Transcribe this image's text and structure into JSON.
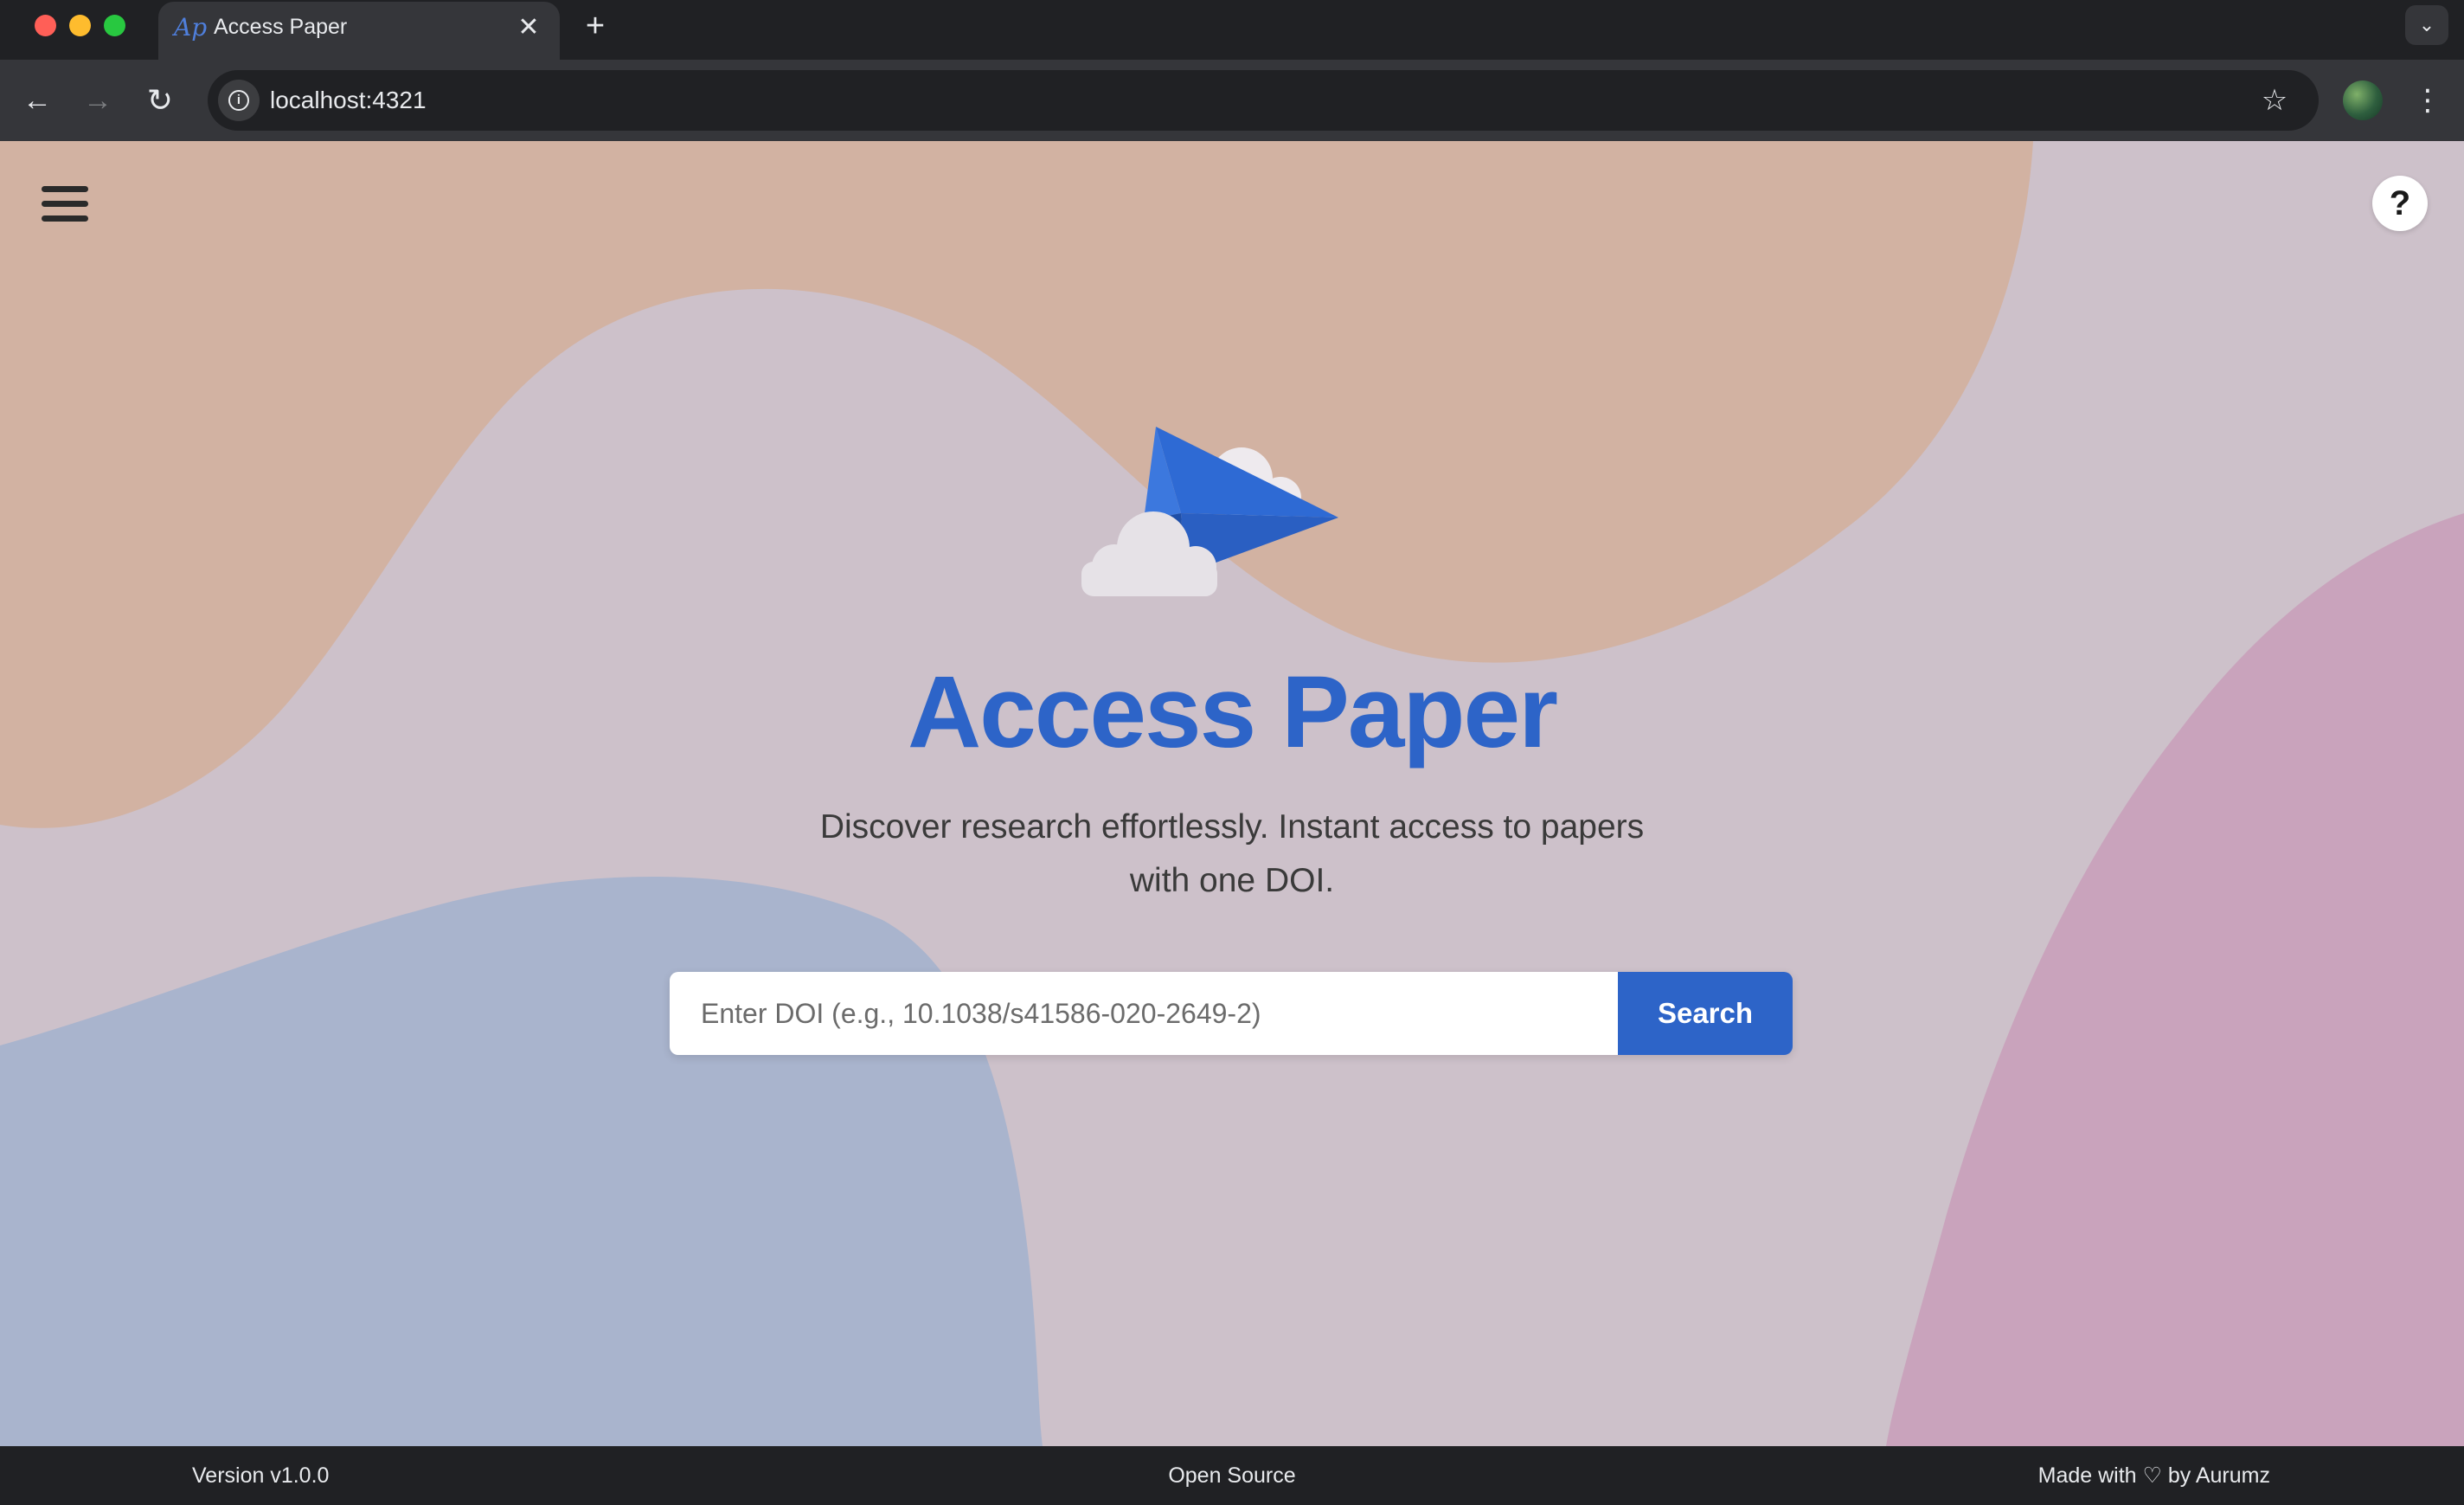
{
  "browser": {
    "tab_title": "Access Paper",
    "tab_favicon": "Ap",
    "tab_close_glyph": "✕",
    "new_tab_glyph": "+",
    "tab_search_glyph": "⌄",
    "url": "localhost:4321",
    "back_glyph": "←",
    "forward_glyph": "→",
    "reload_glyph": "↻",
    "info_glyph": "i",
    "star_glyph": "☆",
    "menu_glyph": "⋮"
  },
  "header": {
    "menu_icon": "hamburger-icon",
    "help_label": "?"
  },
  "hero": {
    "logo_icon": "paper-plane-icon",
    "title": "Access Paper",
    "subtitle_line1": "Discover research effortlessly. Instant access to papers",
    "subtitle_line2": "with one DOI."
  },
  "search": {
    "placeholder": "Enter DOI (e.g., 10.1038/s41586-020-2649-2)",
    "value": "",
    "button_label": "Search"
  },
  "footer": {
    "version": "Version v1.0.0",
    "center": "Open Source",
    "credit": "Made with ♡ by Aurumz"
  },
  "colors": {
    "accent": "#2d64c8",
    "page_bg": "#cdc1ca",
    "blob_peach": "#d2b2a2",
    "blob_blue": "#a9b4cd",
    "blob_pink": "#c9a3bc",
    "chrome_dark": "#202124",
    "chrome_toolbar": "#35363a"
  }
}
